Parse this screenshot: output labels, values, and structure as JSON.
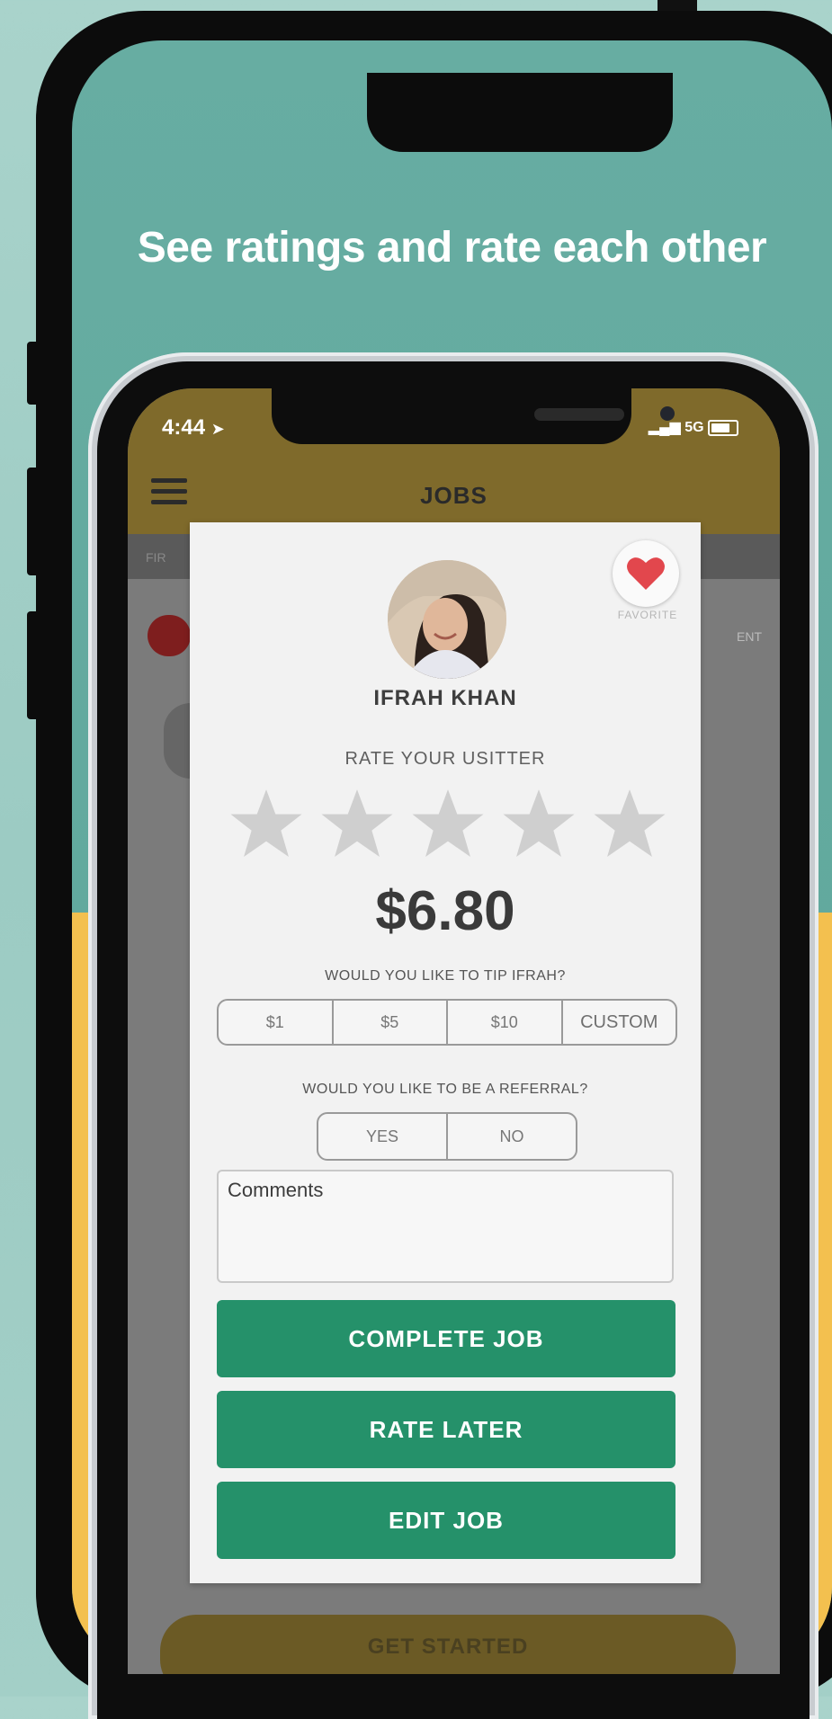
{
  "headline": "See ratings and rate each other",
  "status_bar": {
    "time": "4:44",
    "right": "5G"
  },
  "app_header": {
    "title": "JOBS"
  },
  "background": {
    "sub_band_text": "FIR",
    "ent_text": "ENT",
    "get_started": "GET STARTED"
  },
  "modal": {
    "favorite_label": "FAVORITE",
    "name": "IFRAH KHAN",
    "rate_title": "RATE YOUR USITTER",
    "rating": {
      "value": 0,
      "max": 5
    },
    "price": "$6.80",
    "tip_question": "WOULD YOU LIKE TO TIP IFRAH?",
    "tip_options": [
      "$1",
      "$5",
      "$10",
      "CUSTOM"
    ],
    "referral_question": "WOULD YOU LIKE TO BE A REFERRAL?",
    "referral_options": [
      "YES",
      "NO"
    ],
    "comments_placeholder": "Comments",
    "buttons": {
      "complete": "COMPLETE JOB",
      "later": "RATE LATER",
      "edit": "EDIT JOB"
    }
  },
  "colors": {
    "teal_bg": "#5ea69b",
    "yellow_bg": "#f3c04f",
    "header_brown": "#7f6a2b",
    "button_green": "#25916a",
    "heart_red": "#e2474d",
    "star_gray": "#cfcfcf"
  },
  "icons": [
    "hamburger-icon",
    "heart-icon",
    "star-icon",
    "location-arrow-icon",
    "battery-icon",
    "signal-icon"
  ]
}
